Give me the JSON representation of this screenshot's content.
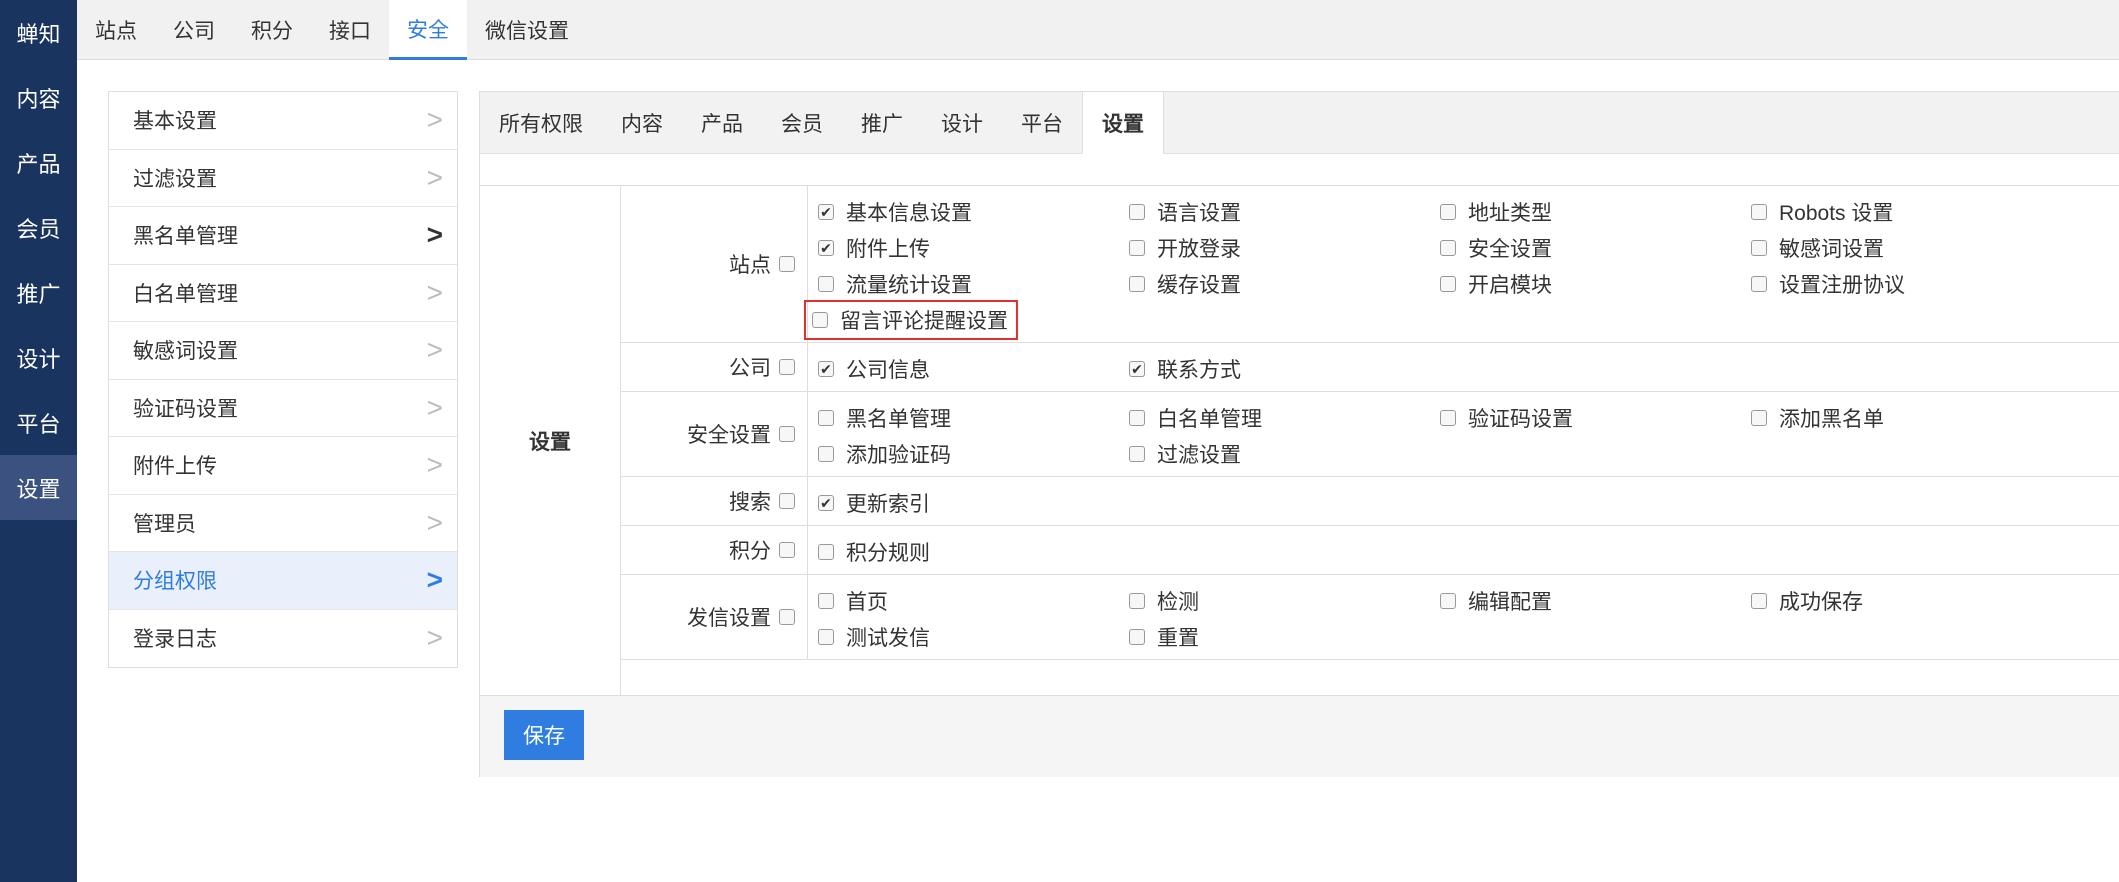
{
  "leftnav": {
    "items": [
      {
        "label": "蝉知"
      },
      {
        "label": "内容"
      },
      {
        "label": "产品"
      },
      {
        "label": "会员"
      },
      {
        "label": "推广"
      },
      {
        "label": "设计"
      },
      {
        "label": "平台"
      },
      {
        "label": "设置"
      }
    ],
    "active_index": 7
  },
  "topbar": {
    "tabs": [
      {
        "label": "站点"
      },
      {
        "label": "公司"
      },
      {
        "label": "积分"
      },
      {
        "label": "接口"
      },
      {
        "label": "安全"
      },
      {
        "label": "微信设置"
      }
    ],
    "active_index": 4
  },
  "sidemenu": {
    "items": [
      {
        "label": "基本设置"
      },
      {
        "label": "过滤设置"
      },
      {
        "label": "黑名单管理"
      },
      {
        "label": "白名单管理"
      },
      {
        "label": "敏感词设置"
      },
      {
        "label": "验证码设置"
      },
      {
        "label": "附件上传"
      },
      {
        "label": "管理员"
      },
      {
        "label": "分组权限"
      },
      {
        "label": "登录日志"
      }
    ],
    "active_index": 8,
    "chevron": ">"
  },
  "panel": {
    "tabs": [
      {
        "label": "所有权限"
      },
      {
        "label": "内容"
      },
      {
        "label": "产品"
      },
      {
        "label": "会员"
      },
      {
        "label": "推广"
      },
      {
        "label": "设计"
      },
      {
        "label": "平台"
      },
      {
        "label": "设置"
      }
    ],
    "active_index": 7,
    "group_label": "设置",
    "rows": [
      {
        "label": "站点",
        "checked": false,
        "options": [
          {
            "label": "基本信息设置",
            "checked": true
          },
          {
            "label": "语言设置",
            "checked": false
          },
          {
            "label": "地址类型",
            "checked": false
          },
          {
            "label": "Robots 设置",
            "checked": false
          },
          {
            "label": "附件上传",
            "checked": true
          },
          {
            "label": "开放登录",
            "checked": false
          },
          {
            "label": "安全设置",
            "checked": false
          },
          {
            "label": "敏感词设置",
            "checked": false
          },
          {
            "label": "流量统计设置",
            "checked": false
          },
          {
            "label": "缓存设置",
            "checked": false
          },
          {
            "label": "开启模块",
            "checked": false
          },
          {
            "label": "设置注册协议",
            "checked": false
          },
          {
            "label": "留言评论提醒设置",
            "checked": false,
            "highlighted": true
          }
        ]
      },
      {
        "label": "公司",
        "checked": false,
        "options": [
          {
            "label": "公司信息",
            "checked": true
          },
          {
            "label": "联系方式",
            "checked": true
          }
        ]
      },
      {
        "label": "安全设置",
        "checked": false,
        "options": [
          {
            "label": "黑名单管理",
            "checked": false
          },
          {
            "label": "白名单管理",
            "checked": false
          },
          {
            "label": "验证码设置",
            "checked": false
          },
          {
            "label": "添加黑名单",
            "checked": false
          },
          {
            "label": "添加验证码",
            "checked": false
          },
          {
            "label": "过滤设置",
            "checked": false
          }
        ]
      },
      {
        "label": "搜索",
        "checked": false,
        "options": [
          {
            "label": "更新索引",
            "checked": true
          }
        ]
      },
      {
        "label": "积分",
        "checked": false,
        "options": [
          {
            "label": "积分规则",
            "checked": false
          }
        ]
      },
      {
        "label": "发信设置",
        "checked": false,
        "options": [
          {
            "label": "首页",
            "checked": false
          },
          {
            "label": "检测",
            "checked": false
          },
          {
            "label": "编辑配置",
            "checked": false
          },
          {
            "label": "成功保存",
            "checked": false
          },
          {
            "label": "测试发信",
            "checked": false
          },
          {
            "label": "重置",
            "checked": false
          }
        ]
      }
    ],
    "save_label": "保存"
  },
  "colors": {
    "nav_bg": "#1a3460",
    "accent": "#2f7de1",
    "highlight_border": "#e03030"
  }
}
